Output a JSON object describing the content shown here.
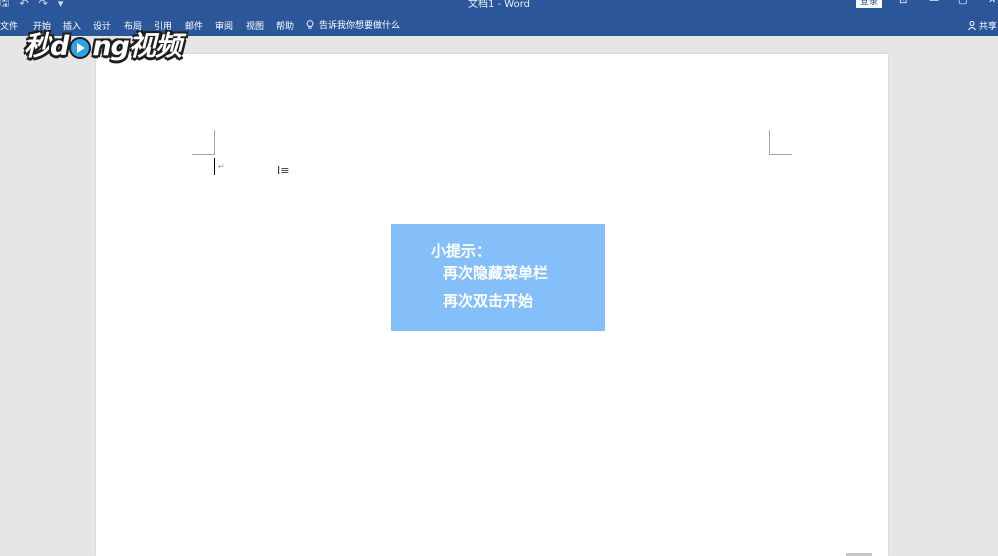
{
  "titlebar": {
    "save_glyph": "🖫",
    "undo_glyph": "↶",
    "redo_glyph": "↷",
    "customize_glyph": "▾",
    "doc_title": "文档1 - Word",
    "signin_label": "登录",
    "ribbon_options_glyph": "⊡",
    "minimize_glyph": "—",
    "maximize_glyph": "▢",
    "close_glyph": "✕"
  },
  "tabs": [
    "文件",
    "开始",
    "插入",
    "设计",
    "布局",
    "引用",
    "邮件",
    "审阅",
    "视图",
    "帮助"
  ],
  "tellme": {
    "label": "告诉我你想要做什么"
  },
  "share": {
    "label": "共享"
  },
  "logo": {
    "text_before": "秒",
    "text_after": "ng视频",
    "d_letter": "d"
  },
  "document": {
    "paragraph_mark": "↵",
    "ibeam": "I≡"
  },
  "tip": {
    "title": "小提示：",
    "line1": "再次隐藏菜单栏",
    "line2": "再次双击开始"
  },
  "colors": {
    "ribbon": "#2b579a",
    "tip_box": "#85bffa",
    "page": "#ffffff",
    "workspace": "#e6e6e6"
  }
}
